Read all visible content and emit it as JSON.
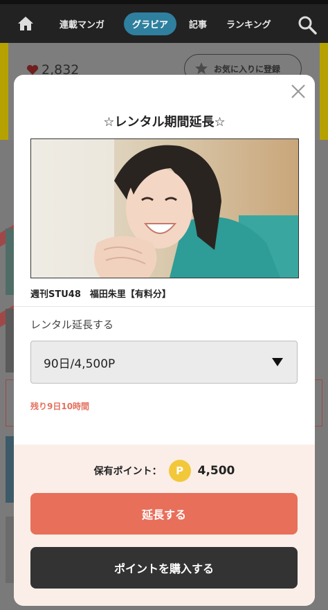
{
  "nav": {
    "items": [
      {
        "label": "連載マンガ",
        "active": false
      },
      {
        "label": "グラビア",
        "active": true
      },
      {
        "label": "記事",
        "active": false
      },
      {
        "label": "ランキング",
        "active": false
      }
    ]
  },
  "background": {
    "like_count": "2,832",
    "favorite_label": "お気に入りに登録"
  },
  "modal": {
    "title": "☆レンタル期間延長☆",
    "product_title": "週刊STU48　福田朱里【有料分】",
    "rental_label": "レンタル延長する",
    "selected_option": "90日/4,500P",
    "remaining": "残り9日10時間",
    "points_label": "保有ポイント：",
    "coin_symbol": "P",
    "points_value": "4,500",
    "extend_button": "延長する",
    "buy_button": "ポイントを購入する"
  },
  "colors": {
    "accent": "#e86f5a",
    "nav_active": "#2f7f9f",
    "coin": "#f2c83a",
    "footer_bg": "#fbeee8"
  }
}
